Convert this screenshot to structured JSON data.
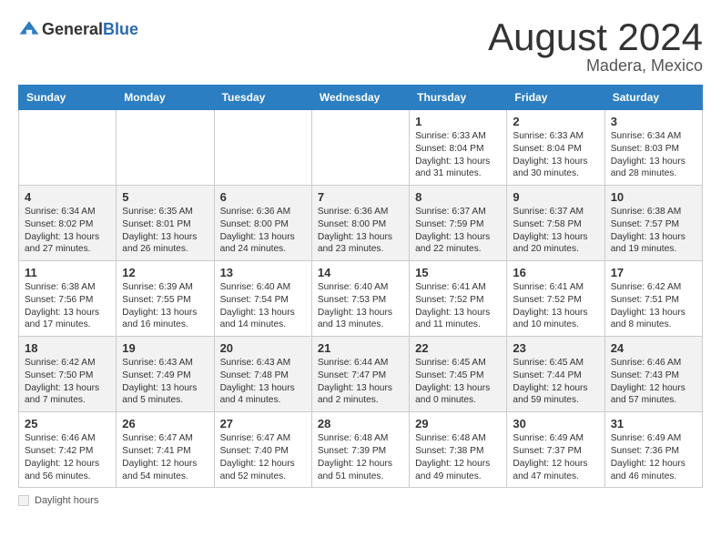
{
  "header": {
    "logo_general": "General",
    "logo_blue": "Blue",
    "month_year": "August 2024",
    "location": "Madera, Mexico"
  },
  "days_of_week": [
    "Sunday",
    "Monday",
    "Tuesday",
    "Wednesday",
    "Thursday",
    "Friday",
    "Saturday"
  ],
  "weeks": [
    [
      {
        "day": "",
        "info": ""
      },
      {
        "day": "",
        "info": ""
      },
      {
        "day": "",
        "info": ""
      },
      {
        "day": "",
        "info": ""
      },
      {
        "day": "1",
        "info": "Sunrise: 6:33 AM\nSunset: 8:04 PM\nDaylight: 13 hours and 31 minutes."
      },
      {
        "day": "2",
        "info": "Sunrise: 6:33 AM\nSunset: 8:04 PM\nDaylight: 13 hours and 30 minutes."
      },
      {
        "day": "3",
        "info": "Sunrise: 6:34 AM\nSunset: 8:03 PM\nDaylight: 13 hours and 28 minutes."
      }
    ],
    [
      {
        "day": "4",
        "info": "Sunrise: 6:34 AM\nSunset: 8:02 PM\nDaylight: 13 hours and 27 minutes."
      },
      {
        "day": "5",
        "info": "Sunrise: 6:35 AM\nSunset: 8:01 PM\nDaylight: 13 hours and 26 minutes."
      },
      {
        "day": "6",
        "info": "Sunrise: 6:36 AM\nSunset: 8:00 PM\nDaylight: 13 hours and 24 minutes."
      },
      {
        "day": "7",
        "info": "Sunrise: 6:36 AM\nSunset: 8:00 PM\nDaylight: 13 hours and 23 minutes."
      },
      {
        "day": "8",
        "info": "Sunrise: 6:37 AM\nSunset: 7:59 PM\nDaylight: 13 hours and 22 minutes."
      },
      {
        "day": "9",
        "info": "Sunrise: 6:37 AM\nSunset: 7:58 PM\nDaylight: 13 hours and 20 minutes."
      },
      {
        "day": "10",
        "info": "Sunrise: 6:38 AM\nSunset: 7:57 PM\nDaylight: 13 hours and 19 minutes."
      }
    ],
    [
      {
        "day": "11",
        "info": "Sunrise: 6:38 AM\nSunset: 7:56 PM\nDaylight: 13 hours and 17 minutes."
      },
      {
        "day": "12",
        "info": "Sunrise: 6:39 AM\nSunset: 7:55 PM\nDaylight: 13 hours and 16 minutes."
      },
      {
        "day": "13",
        "info": "Sunrise: 6:40 AM\nSunset: 7:54 PM\nDaylight: 13 hours and 14 minutes."
      },
      {
        "day": "14",
        "info": "Sunrise: 6:40 AM\nSunset: 7:53 PM\nDaylight: 13 hours and 13 minutes."
      },
      {
        "day": "15",
        "info": "Sunrise: 6:41 AM\nSunset: 7:52 PM\nDaylight: 13 hours and 11 minutes."
      },
      {
        "day": "16",
        "info": "Sunrise: 6:41 AM\nSunset: 7:52 PM\nDaylight: 13 hours and 10 minutes."
      },
      {
        "day": "17",
        "info": "Sunrise: 6:42 AM\nSunset: 7:51 PM\nDaylight: 13 hours and 8 minutes."
      }
    ],
    [
      {
        "day": "18",
        "info": "Sunrise: 6:42 AM\nSunset: 7:50 PM\nDaylight: 13 hours and 7 minutes."
      },
      {
        "day": "19",
        "info": "Sunrise: 6:43 AM\nSunset: 7:49 PM\nDaylight: 13 hours and 5 minutes."
      },
      {
        "day": "20",
        "info": "Sunrise: 6:43 AM\nSunset: 7:48 PM\nDaylight: 13 hours and 4 minutes."
      },
      {
        "day": "21",
        "info": "Sunrise: 6:44 AM\nSunset: 7:47 PM\nDaylight: 13 hours and 2 minutes."
      },
      {
        "day": "22",
        "info": "Sunrise: 6:45 AM\nSunset: 7:45 PM\nDaylight: 13 hours and 0 minutes."
      },
      {
        "day": "23",
        "info": "Sunrise: 6:45 AM\nSunset: 7:44 PM\nDaylight: 12 hours and 59 minutes."
      },
      {
        "day": "24",
        "info": "Sunrise: 6:46 AM\nSunset: 7:43 PM\nDaylight: 12 hours and 57 minutes."
      }
    ],
    [
      {
        "day": "25",
        "info": "Sunrise: 6:46 AM\nSunset: 7:42 PM\nDaylight: 12 hours and 56 minutes."
      },
      {
        "day": "26",
        "info": "Sunrise: 6:47 AM\nSunset: 7:41 PM\nDaylight: 12 hours and 54 minutes."
      },
      {
        "day": "27",
        "info": "Sunrise: 6:47 AM\nSunset: 7:40 PM\nDaylight: 12 hours and 52 minutes."
      },
      {
        "day": "28",
        "info": "Sunrise: 6:48 AM\nSunset: 7:39 PM\nDaylight: 12 hours and 51 minutes."
      },
      {
        "day": "29",
        "info": "Sunrise: 6:48 AM\nSunset: 7:38 PM\nDaylight: 12 hours and 49 minutes."
      },
      {
        "day": "30",
        "info": "Sunrise: 6:49 AM\nSunset: 7:37 PM\nDaylight: 12 hours and 47 minutes."
      },
      {
        "day": "31",
        "info": "Sunrise: 6:49 AM\nSunset: 7:36 PM\nDaylight: 12 hours and 46 minutes."
      }
    ]
  ],
  "footer": {
    "daylight_label": "Daylight hours"
  }
}
